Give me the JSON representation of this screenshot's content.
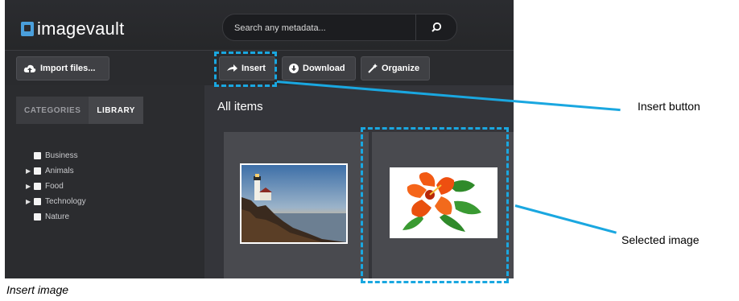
{
  "app": {
    "logo_text": "imagevault",
    "search_placeholder": "Search any metadata..."
  },
  "toolbar": {
    "import_label": "Import files...",
    "insert_label": "Insert",
    "download_label": "Download",
    "organize_label": "Organize"
  },
  "sidebar": {
    "tabs": [
      {
        "label": "CATEGORIES",
        "active": false
      },
      {
        "label": "LIBRARY",
        "active": true
      }
    ],
    "items": [
      {
        "label": "Business",
        "expandable": false
      },
      {
        "label": "Animals",
        "expandable": true
      },
      {
        "label": "Food",
        "expandable": true
      },
      {
        "label": "Technology",
        "expandable": true
      },
      {
        "label": "Nature",
        "expandable": false
      }
    ]
  },
  "main": {
    "title": "All items"
  },
  "annotations": {
    "insert_label": "Insert button",
    "selected_label": "Selected image",
    "caption": "Insert image",
    "color": "#1aa7e0"
  },
  "colors": {
    "app_bg": "#2f3034",
    "accent": "#1aa7e0"
  }
}
